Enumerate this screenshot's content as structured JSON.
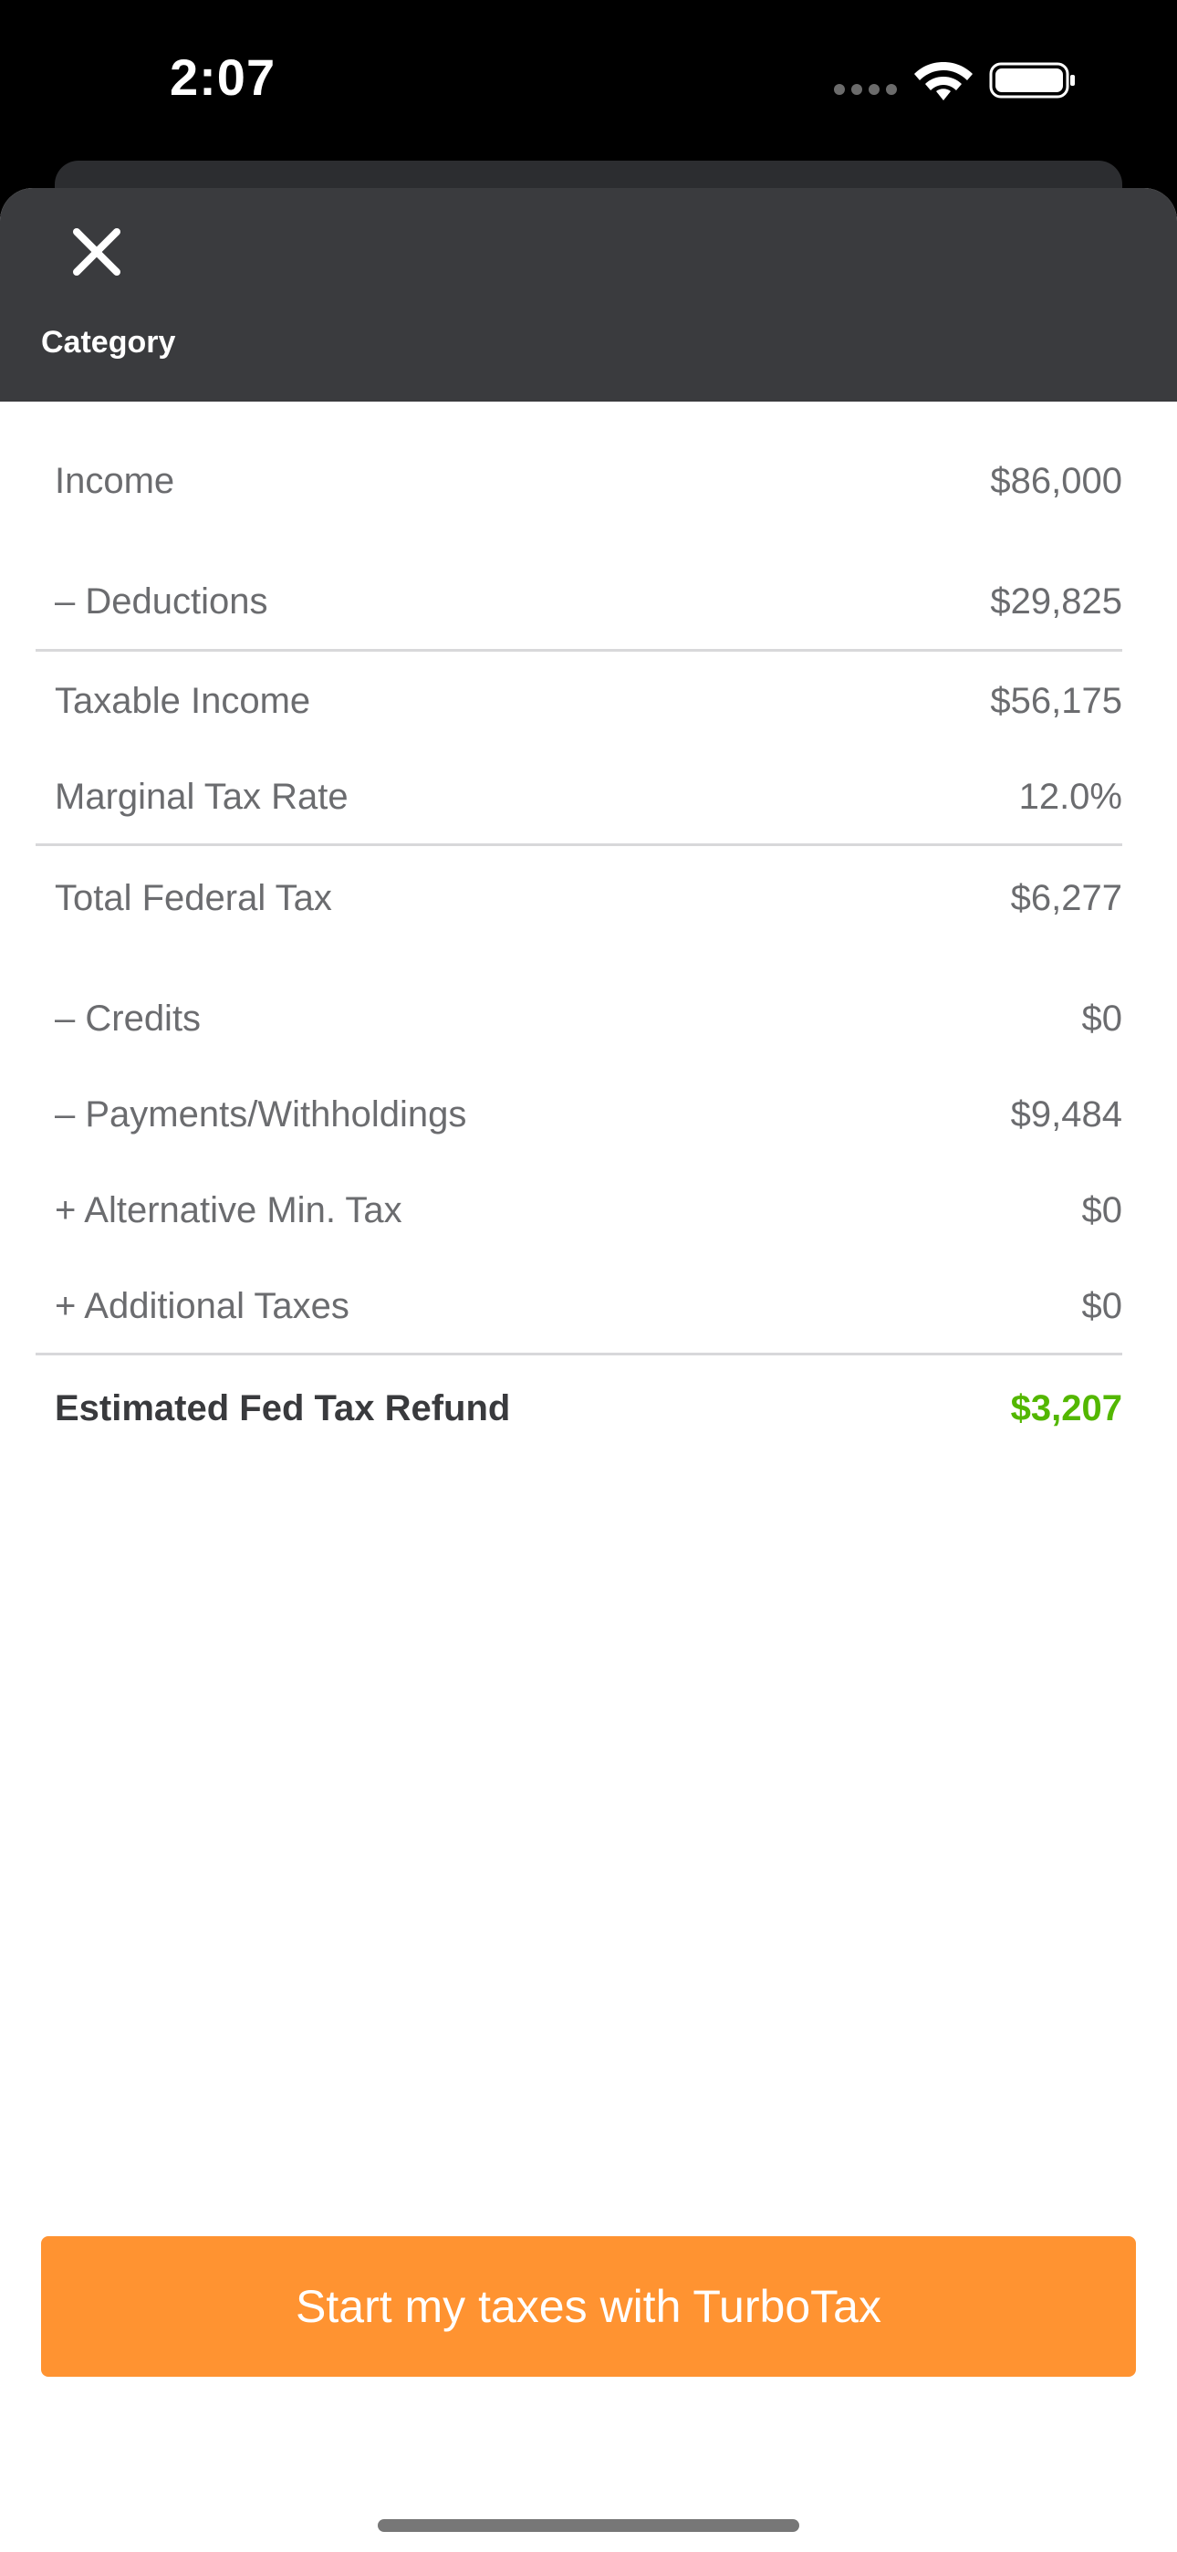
{
  "status_bar": {
    "time": "2:07"
  },
  "header": {
    "title": "Category"
  },
  "rows": [
    {
      "label": "Income",
      "value": "$86,000"
    },
    {
      "label": "– Deductions",
      "value": "$29,825"
    },
    {
      "label": "Taxable Income",
      "value": "$56,175"
    },
    {
      "label": "Marginal Tax Rate",
      "value": "12.0%"
    },
    {
      "label": "Total Federal Tax",
      "value": "$6,277"
    },
    {
      "label": "– Credits",
      "value": "$0"
    },
    {
      "label": "– Payments/Withholdings",
      "value": "$9,484"
    },
    {
      "label": "+ Alternative Min. Tax",
      "value": "$0"
    },
    {
      "label": "+ Additional Taxes",
      "value": "$0"
    }
  ],
  "total": {
    "label": "Estimated Fed Tax Refund",
    "value": "$3,207"
  },
  "cta": {
    "label": "Start my taxes with TurboTax"
  },
  "icons": {
    "close": "close-icon",
    "wifi": "wifi-icon",
    "battery": "battery-icon",
    "cellular": "cellular-signal-icon"
  },
  "colors": {
    "header_bg": "#3a3b3e",
    "refund_value": "#53b700",
    "cta_bg": "#ff9331"
  }
}
